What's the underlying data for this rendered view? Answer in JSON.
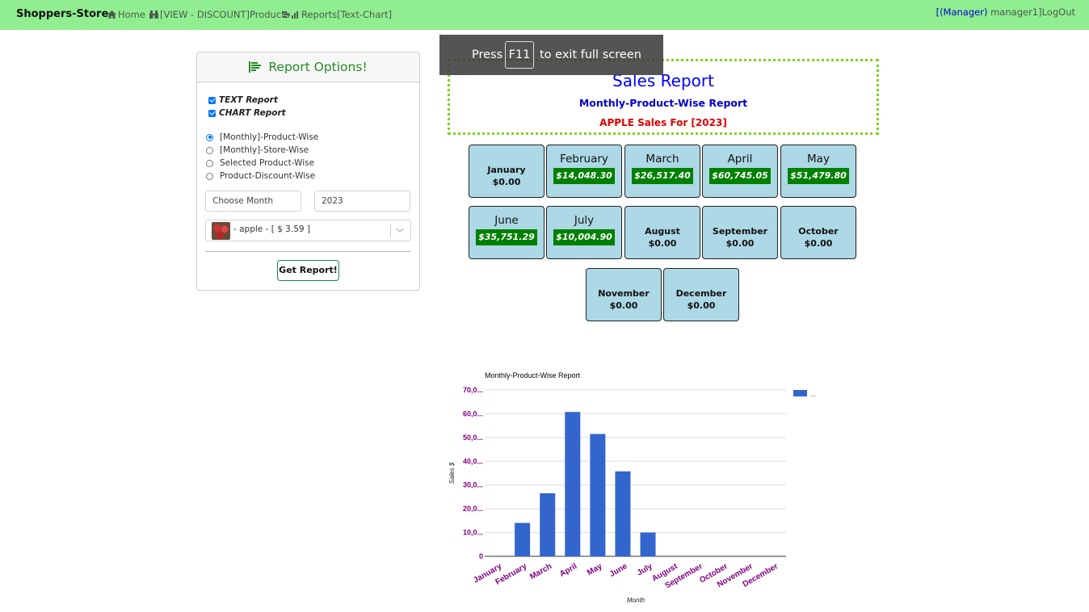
{
  "navbar": {
    "brand": "Shoppers-Store",
    "home": "Home",
    "discount": "[VIEW - DISCOUNT]Products",
    "reports": "Reports[Text-Chart]",
    "user_open": "[",
    "user_role": "(Manager)",
    "user_name": " manager1]LogOut"
  },
  "fullscreen_toast": {
    "press": "Press",
    "key": "F11",
    "rest": "to exit full screen"
  },
  "options": {
    "title": "Report Options!",
    "checks": [
      "TEXT Report",
      "CHART Report"
    ],
    "radios": [
      "[Monthly]-Product-Wise",
      "[Monthly]-Store-Wise",
      "Selected Product-Wise",
      "Product-Discount-Wise"
    ],
    "selected_radio": 0,
    "month_placeholder": "Choose Month",
    "year_value": "2023",
    "product_value": "- apple - [ $ 3.59 ]",
    "button": "Get Report!"
  },
  "report": {
    "title": "Sales Report",
    "subtitle": "Monthly-Product-Wise Report",
    "subtitle2": "APPLE Sales For [2023]"
  },
  "months": [
    {
      "name": "January",
      "value": "$0.00",
      "has": false
    },
    {
      "name": "February",
      "value": "$14,048.30",
      "has": true
    },
    {
      "name": "March",
      "value": "$26,517.40",
      "has": true
    },
    {
      "name": "April",
      "value": "$60,745.05",
      "has": true
    },
    {
      "name": "May",
      "value": "$51,479.80",
      "has": true
    },
    {
      "name": "June",
      "value": "$35,751.29",
      "has": true
    },
    {
      "name": "July",
      "value": "$10,004.90",
      "has": true
    },
    {
      "name": "August",
      "value": "$0.00",
      "has": false
    },
    {
      "name": "September",
      "value": "$0.00",
      "has": false
    },
    {
      "name": "October",
      "value": "$0.00",
      "has": false
    },
    {
      "name": "November",
      "value": "$0.00",
      "has": false
    },
    {
      "name": "December",
      "value": "$0.00",
      "has": false
    }
  ],
  "colors": {
    "navbar": "#90ee90",
    "tile": "#add8e6",
    "value_bg": "#008000",
    "bar": "#3366cc",
    "axis_text": "#800080"
  },
  "chart_data": {
    "type": "bar",
    "title": "Monthly-Product-Wise Report",
    "xlabel": "Month",
    "ylabel": "Sales $",
    "categories": [
      "January",
      "February",
      "March",
      "April",
      "May",
      "June",
      "July",
      "August",
      "September",
      "October",
      "November",
      "December"
    ],
    "values": [
      0,
      14048.3,
      26517.4,
      60745.05,
      51479.8,
      35751.29,
      10004.9,
      0,
      0,
      0,
      0,
      0
    ],
    "yticks": [
      "0",
      "10,0...",
      "20,0...",
      "30,0...",
      "40,0...",
      "50,0...",
      "60,0...",
      "70,0..."
    ],
    "ylim": [
      0,
      70000
    ],
    "legend": "...",
    "legend_position": "right",
    "grid": true
  }
}
